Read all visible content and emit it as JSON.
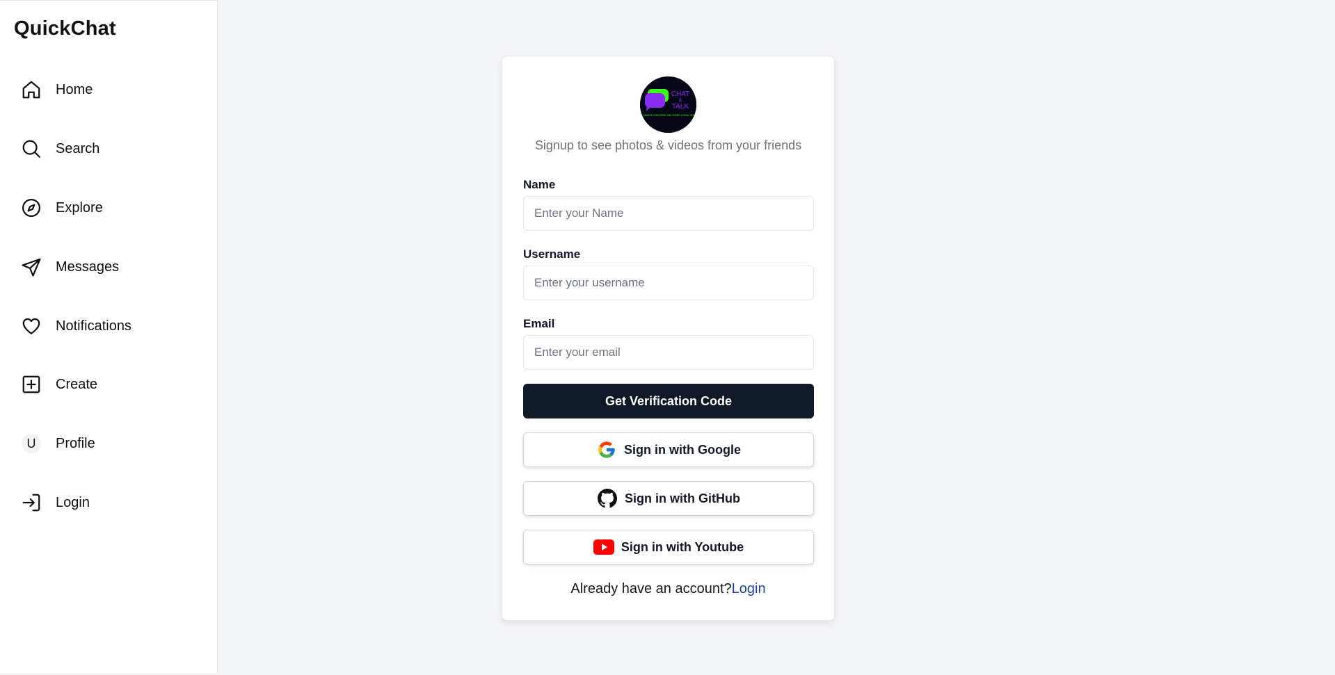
{
  "app": {
    "brand": "QuickChat"
  },
  "sidebar": {
    "items": [
      {
        "label": "Home",
        "icon": "home-icon"
      },
      {
        "label": "Search",
        "icon": "search-icon"
      },
      {
        "label": "Explore",
        "icon": "compass-icon"
      },
      {
        "label": "Messages",
        "icon": "send-icon"
      },
      {
        "label": "Notifications",
        "icon": "heart-icon"
      },
      {
        "label": "Create",
        "icon": "plus-square-icon"
      },
      {
        "label": "Profile",
        "icon": "avatar",
        "avatar_initial": "U"
      },
      {
        "label": "Login",
        "icon": "login-icon"
      }
    ]
  },
  "signup": {
    "logo": {
      "line1": "CHAT",
      "line2": "&",
      "line3": "TALK",
      "tagline": "CONNECT, CONVERSE, AND SHARE IN REAL TIME"
    },
    "subtitle": "Signup to see photos & videos from your friends",
    "fields": {
      "name": {
        "label": "Name",
        "placeholder": "Enter your Name",
        "value": ""
      },
      "username": {
        "label": "Username",
        "placeholder": "Enter your username",
        "value": ""
      },
      "email": {
        "label": "Email",
        "placeholder": "Enter your email",
        "value": ""
      }
    },
    "primary_button": "Get Verification Code",
    "social": {
      "google": "Sign in with Google",
      "github": "Sign in with GitHub",
      "youtube": "Sign in with Youtube"
    },
    "footer": {
      "text": "Already have an account?",
      "link": "Login"
    }
  },
  "colors": {
    "background": "#f3f4f6",
    "primary_button": "#111827",
    "link": "#1e40af",
    "youtube_red": "#ff0000"
  }
}
